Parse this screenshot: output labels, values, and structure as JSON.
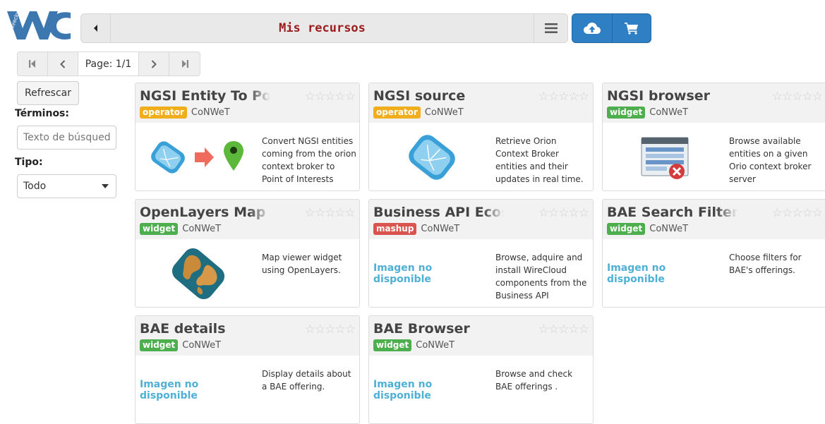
{
  "header": {
    "logo_text": "Wirecloud",
    "title": "Mis recursos",
    "back_icon": "caret-left-icon",
    "menu_icon": "hamburger-icon",
    "upload_icon": "cloud-upload-icon",
    "cart_icon": "cart-icon",
    "accent": "#2f7fc4",
    "title_color": "#9b1c1c"
  },
  "pagination": {
    "page_label": "Page: 1/1"
  },
  "sidebar": {
    "refresh_label": "Refrescar",
    "terms_label": "Términos:",
    "search_placeholder": "Texto de búsqueda..",
    "type_label": "Tipo:",
    "type_value": "Todo"
  },
  "cards": [
    {
      "name": "NGSI Entity To PoI",
      "type": "operator",
      "vendor": "CoNWeT",
      "image": "ngsi-to-poi",
      "description": "Convert NGSI entities coming from the orion context broker to Point of Interests"
    },
    {
      "name": "NGSI source",
      "type": "operator",
      "vendor": "CoNWeT",
      "image": "ngsi",
      "description": "Retrieve Orion Context Broker entities and their updates in real time."
    },
    {
      "name": "NGSI browser",
      "type": "widget",
      "vendor": "CoNWeT",
      "image": "browser",
      "description": "Browse available entities on a given Orio context broker server"
    },
    {
      "name": "OpenLayers Map",
      "type": "widget",
      "vendor": "CoNWeT",
      "image": "map",
      "description": "Map viewer widget using OpenLayers."
    },
    {
      "name": "Business API Ecosystem",
      "type": "mashup",
      "vendor": "CoNWeT",
      "image": "none",
      "no_image_text": "Imagen no disponible",
      "description": "Browse, adquire and install WireCloud components from the Business API"
    },
    {
      "name": "BAE Search Filters",
      "type": "widget",
      "vendor": "CoNWeT",
      "image": "none",
      "no_image_text": "Imagen no disponible",
      "description": "Choose filters for BAE's offerings."
    },
    {
      "name": "BAE details",
      "type": "widget",
      "vendor": "CoNWeT",
      "image": "none",
      "no_image_text": "Imagen no disponible",
      "description": "Display details about a BAE offering."
    },
    {
      "name": "BAE Browser",
      "type": "widget",
      "vendor": "CoNWeT",
      "image": "none",
      "no_image_text": "Imagen no disponible",
      "description": "Browse and check BAE offerings ."
    }
  ]
}
